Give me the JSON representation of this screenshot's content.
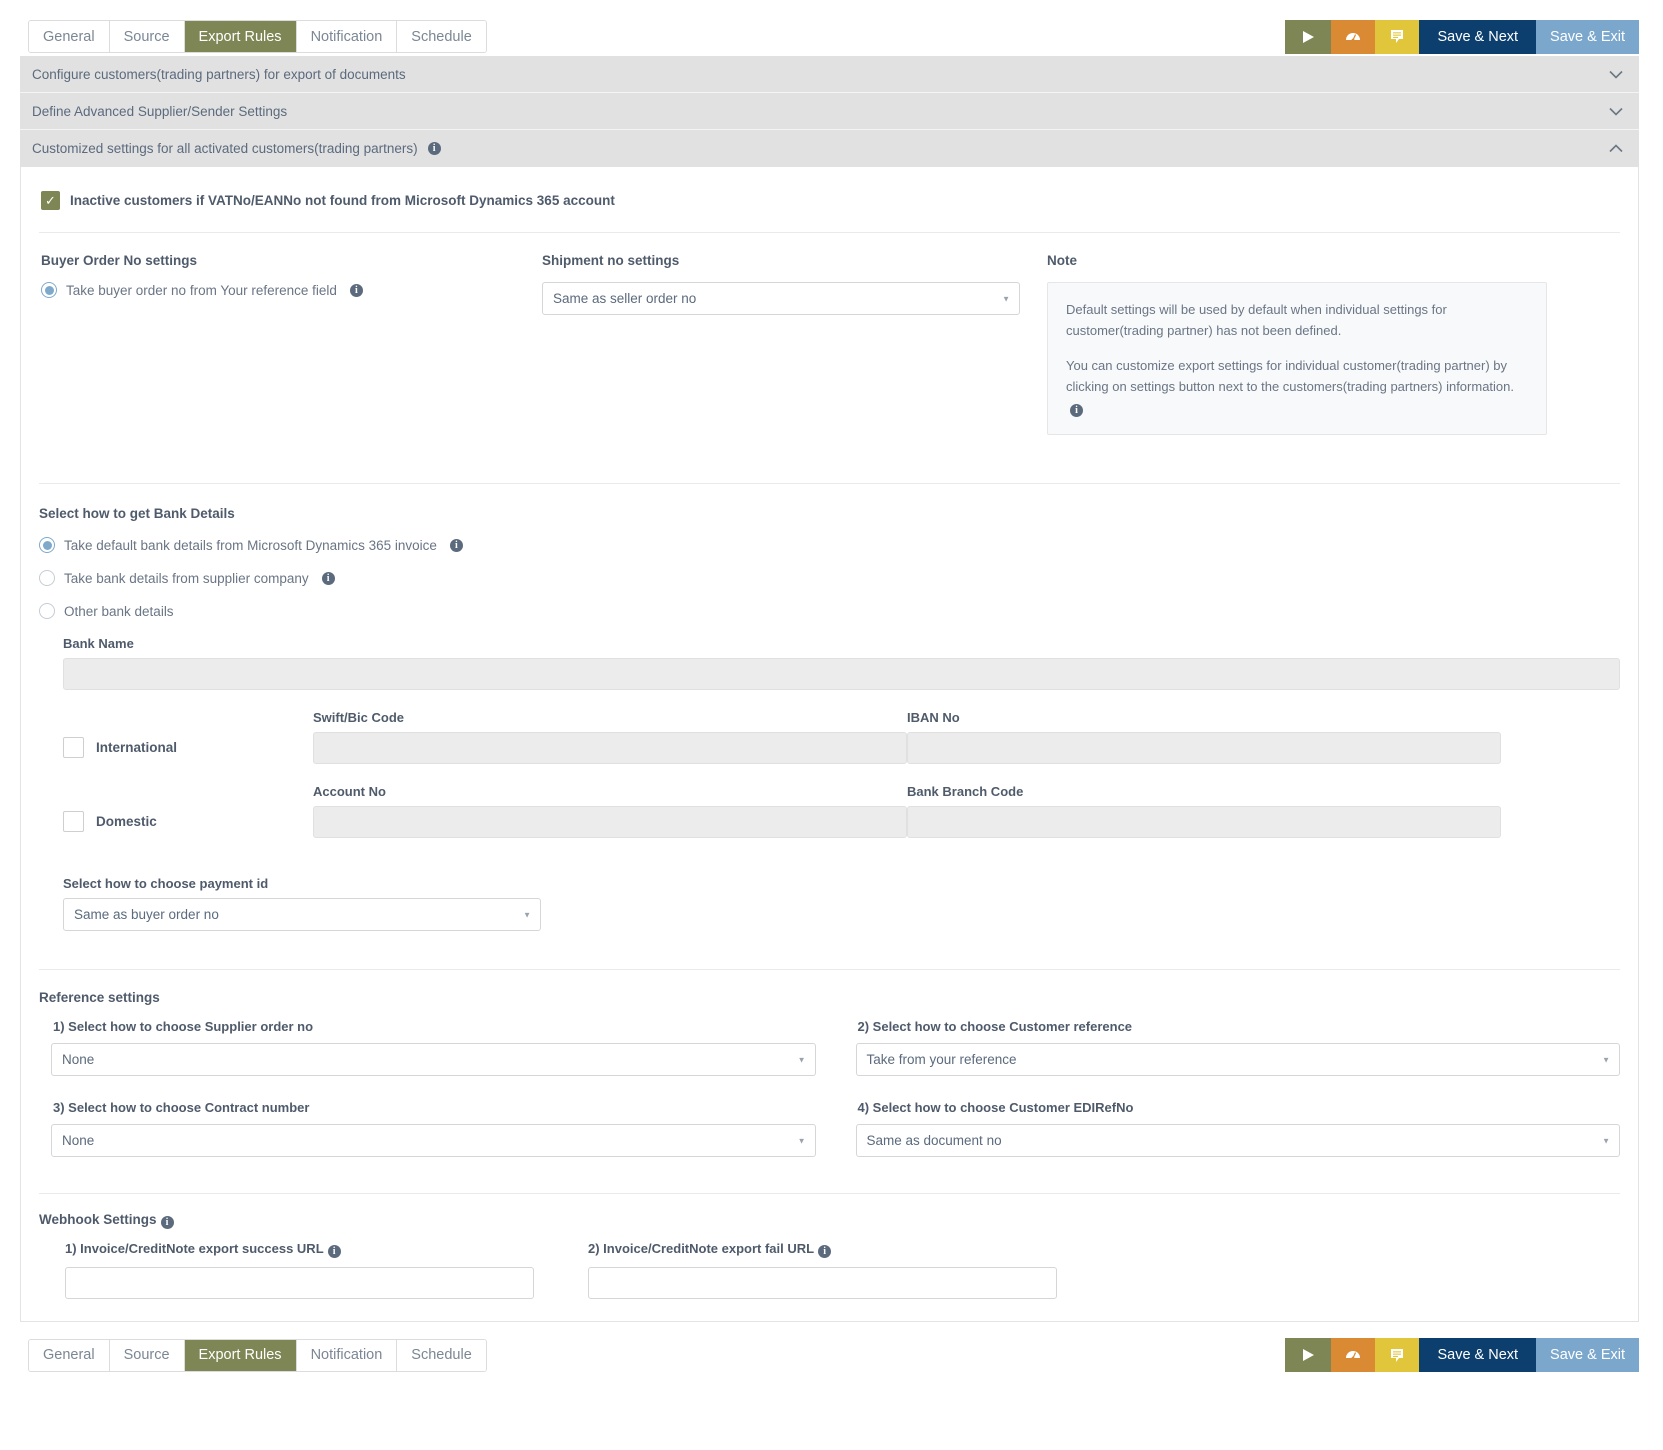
{
  "tabs": [
    {
      "label": "General",
      "active": false
    },
    {
      "label": "Source",
      "active": false
    },
    {
      "label": "Export Rules",
      "active": true
    },
    {
      "label": "Notification",
      "active": false
    },
    {
      "label": "Schedule",
      "active": false
    }
  ],
  "toolbar": {
    "play_icon": "play-icon",
    "gauge_icon": "dashboard-gauge-icon",
    "doc_icon": "document-icon",
    "save_next_label": "Save & Next",
    "save_exit_label": "Save & Exit",
    "colors": {
      "olive": "#7d8654",
      "orange": "#d98a33",
      "yellow": "#e1c63c",
      "dark_blue": "#0c3f6e",
      "light_blue": "#7ba7cc"
    }
  },
  "accordions": [
    {
      "title": "Configure customers(trading partners) for export of documents",
      "expanded": false,
      "chevron": "⌄",
      "has_info": false
    },
    {
      "title": "Define Advanced Supplier/Sender Settings",
      "expanded": false,
      "chevron": "⌄",
      "has_info": false
    },
    {
      "title": "Customized settings for all activated customers(trading partners)",
      "expanded": true,
      "chevron": "⌃",
      "has_info": true
    }
  ],
  "inactive_customers": {
    "label": "Inactive customers if VATNo/EANNo not found from Microsoft Dynamics 365 account",
    "checked": true,
    "check_glyph": "✓"
  },
  "buyer_order": {
    "section_label": "Buyer Order No settings",
    "option_label": "Take buyer order no from Your reference field",
    "selected": true
  },
  "shipment": {
    "section_label": "Shipment no settings",
    "value": "Same as seller order no"
  },
  "note": {
    "section_label": "Note",
    "paragraph_1": "Default settings will be used by default when individual settings for customer(trading partner) has not been defined.",
    "paragraph_2": "You can customize export settings for individual customer(trading partner) by clicking on settings button next to the customers(trading partners) information."
  },
  "bank_details": {
    "section_label": "Select how to get Bank Details",
    "options": [
      {
        "label": "Take default bank details from Microsoft Dynamics 365 invoice",
        "selected": true,
        "has_info": true
      },
      {
        "label": "Take bank details from supplier company",
        "selected": false,
        "has_info": true
      },
      {
        "label": "Other bank details",
        "selected": false,
        "has_info": false
      }
    ],
    "bank_name_label": "Bank Name",
    "bank_name_value": "",
    "international_label": "International",
    "international_checked": false,
    "domestic_label": "Domestic",
    "domestic_checked": false,
    "swift_label": "Swift/Bic Code",
    "swift_value": "",
    "iban_label": "IBAN No",
    "iban_value": "",
    "account_no_label": "Account No",
    "account_no_value": "",
    "branch_code_label": "Bank Branch Code",
    "branch_code_value": "",
    "payment_id_label": "Select how to choose payment id",
    "payment_id_value": "Same as buyer order no"
  },
  "reference_settings": {
    "section_label": "Reference settings",
    "items": [
      {
        "label": "1) Select how to choose Supplier order no",
        "value": "None"
      },
      {
        "label": "2) Select how to choose Customer reference",
        "value": "Take from your reference"
      },
      {
        "label": "3) Select how to choose Contract number",
        "value": "None"
      },
      {
        "label": "4) Select how to choose Customer EDIRefNo",
        "value": "Same as document no"
      }
    ]
  },
  "webhook_settings": {
    "section_label": "Webhook Settings",
    "items": [
      {
        "label": "1) Invoice/CreditNote export success URL",
        "value": ""
      },
      {
        "label": "2) Invoice/CreditNote export fail URL",
        "value": ""
      }
    ]
  }
}
